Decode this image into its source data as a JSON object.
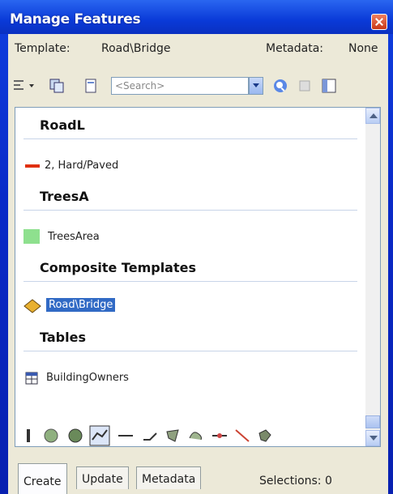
{
  "window": {
    "title": "Manage Features"
  },
  "info": {
    "template_label": "Template:",
    "template_value": "Road\\Bridge",
    "metadata_label": "Metadata:",
    "metadata_value": "None"
  },
  "search": {
    "placeholder": "<Search>"
  },
  "groups": [
    {
      "header": "RoadL",
      "item": "2, Hard/Paved",
      "icon": "red-line-icon"
    },
    {
      "header": "TreesA",
      "item": "TreesArea",
      "icon": "green-square-icon"
    },
    {
      "header": "Composite Templates",
      "item": "Road\\Bridge",
      "icon": "diamond-icon"
    },
    {
      "header": "Tables",
      "item": "BuildingOwners",
      "icon": "table-icon"
    }
  ],
  "tabs": [
    "Create",
    "Update",
    "Metadata"
  ],
  "status": {
    "selections": "Selections: 0"
  },
  "colors": {
    "title_bar": "#0a3ad8",
    "selection": "#316ac5",
    "line": "#e03010",
    "area": "#8ee08e"
  }
}
